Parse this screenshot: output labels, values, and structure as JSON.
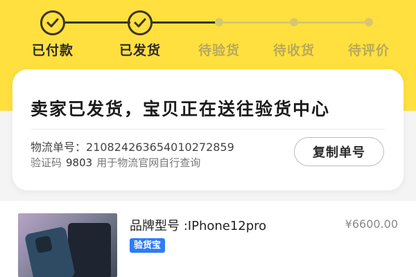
{
  "progress": {
    "steps": [
      {
        "label": "已付款",
        "state": "done"
      },
      {
        "label": "已发货",
        "state": "done"
      },
      {
        "label": "待验货",
        "state": "pending"
      },
      {
        "label": "待收货",
        "state": "pending"
      },
      {
        "label": "待评价",
        "state": "pending"
      }
    ]
  },
  "status_card": {
    "title": "卖家已发货，宝贝正在送往验货中心",
    "tracking_label": "物流单号：",
    "tracking_number": "21082426365401027285​9",
    "verify_label": "验证码",
    "verify_code": "9803",
    "verify_hint": "用于物流官网自行查询",
    "copy_button": "复制单号"
  },
  "product": {
    "title": "品牌型号 :IPhone12pro",
    "price": "¥6600.00",
    "badge": "验货宝"
  },
  "colors": {
    "accent": "#ffe03f",
    "badge": "#2f7cf6",
    "done": "#3a3520",
    "pending": "#b8a95a"
  }
}
